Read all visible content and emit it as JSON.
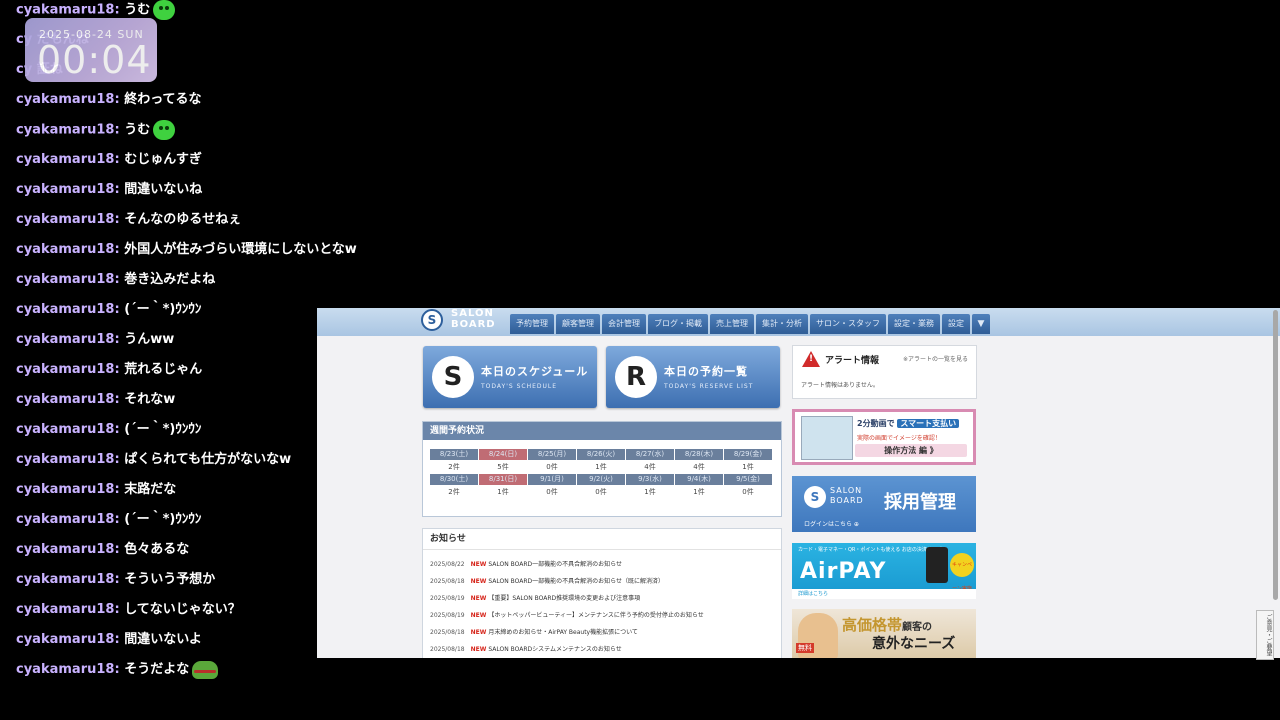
{
  "clock": {
    "date": "2025-08-24 SUN",
    "time": "00:04"
  },
  "chat": [
    {
      "user": "cyakamaru18:",
      "text": "うむ",
      "emote": "green-face-emote"
    },
    {
      "user": "cy",
      "text": "だもんね",
      "emote": ""
    },
    {
      "user": "cy",
      "text": "証ね",
      "emote": ""
    },
    {
      "user": "cyakamaru18:",
      "text": "終わってるな",
      "emote": ""
    },
    {
      "user": "cyakamaru18:",
      "text": "うむ",
      "emote": "green-face-emote"
    },
    {
      "user": "cyakamaru18:",
      "text": "むじゅんすぎ",
      "emote": ""
    },
    {
      "user": "cyakamaru18:",
      "text": "間違いないね",
      "emote": ""
    },
    {
      "user": "cyakamaru18:",
      "text": "そんなのゆるせねぇ",
      "emote": ""
    },
    {
      "user": "cyakamaru18:",
      "text": "外国人が住みづらい環境にしないとなw",
      "emote": ""
    },
    {
      "user": "cyakamaru18:",
      "text": "巻き込みだよね",
      "emote": ""
    },
    {
      "user": "cyakamaru18:",
      "text": "(´ー｀*)ｳﾝｳﾝ",
      "emote": ""
    },
    {
      "user": "cyakamaru18:",
      "text": "うんww",
      "emote": ""
    },
    {
      "user": "cyakamaru18:",
      "text": "荒れるじゃん",
      "emote": ""
    },
    {
      "user": "cyakamaru18:",
      "text": "それなw",
      "emote": ""
    },
    {
      "user": "cyakamaru18:",
      "text": "(´ー｀*)ｳﾝｳﾝ",
      "emote": ""
    },
    {
      "user": "cyakamaru18:",
      "text": "ぱくられても仕方がないなw",
      "emote": ""
    },
    {
      "user": "cyakamaru18:",
      "text": "末路だな",
      "emote": ""
    },
    {
      "user": "cyakamaru18:",
      "text": "(´ー｀*)ｳﾝｳﾝ",
      "emote": ""
    },
    {
      "user": "cyakamaru18:",
      "text": "色々あるな",
      "emote": ""
    },
    {
      "user": "cyakamaru18:",
      "text": "そういう予想か",
      "emote": ""
    },
    {
      "user": "cyakamaru18:",
      "text": "してないじゃない？",
      "emote": ""
    },
    {
      "user": "cyakamaru18:",
      "text": "間違いないよ",
      "emote": ""
    },
    {
      "user": "cyakamaru18:",
      "text": "そうだよな",
      "emote": "frog-emote"
    }
  ],
  "site": {
    "logo": {
      "mark": "S",
      "line1": "SALON",
      "line2": "BOARD"
    },
    "nav": [
      "予約管理",
      "顧客管理",
      "会計管理",
      "ブログ・掲載",
      "売上管理",
      "集計・分析",
      "サロン・スタッフ",
      "設定・業務",
      "設定"
    ],
    "nav_more": "▼",
    "schedule_btn": {
      "icon": "S",
      "title": "本日のスケジュール",
      "sub": "TODAY'S SCHEDULE"
    },
    "reserve_btn": {
      "icon": "R",
      "title": "本日の予約一覧",
      "sub": "TODAY'S RESERVE LIST"
    },
    "weekly": {
      "title": "週間予約状況",
      "week1": {
        "dates": [
          "8/23(土)",
          "8/24(日)",
          "8/25(月)",
          "8/26(火)",
          "8/27(水)",
          "8/28(木)",
          "8/29(金)"
        ],
        "counts": [
          "2件",
          "5件",
          "0件",
          "1件",
          "4件",
          "4件",
          "1件"
        ]
      },
      "week2": {
        "dates": [
          "8/30(土)",
          "8/31(日)",
          "9/1(月)",
          "9/2(火)",
          "9/3(水)",
          "9/4(木)",
          "9/5(金)"
        ],
        "counts": [
          "2件",
          "1件",
          "0件",
          "0件",
          "1件",
          "1件",
          "0件"
        ]
      }
    },
    "news": {
      "title": "お知らせ",
      "items": [
        {
          "date": "2025/08/22",
          "new": "NEW",
          "text": "SALON BOARD一部機能の不具合解消のお知らせ"
        },
        {
          "date": "2025/08/18",
          "new": "NEW",
          "text": "SALON BOARD一部機能の不具合解消のお知らせ（既に解消済）"
        },
        {
          "date": "2025/08/19",
          "new": "NEW",
          "text": "【重要】SALON BOARD推奨環境の変更および注意事項"
        },
        {
          "date": "2025/08/19",
          "new": "NEW",
          "text": "【ホットペッパービューティー】メンテナンスに伴う予約の受付停止のお知らせ"
        },
        {
          "date": "2025/08/18",
          "new": "NEW",
          "text": "月末締めのお知らせ・AirPAY Beauty機能拡張について"
        },
        {
          "date": "2025/08/18",
          "new": "NEW",
          "text": "SALON BOARDシステムメンテナンスのお知らせ"
        }
      ]
    },
    "alert": {
      "title": "アラート情報",
      "link": "※アラートの一覧を見る",
      "body": "アラート情報はありません。"
    },
    "ad_video": {
      "prefix": "2分動画で",
      "highlight": "スマート支払い",
      "sub": "実際の画面でイメージを確認！",
      "button": "操作方法 編 》"
    },
    "ad_recruit": {
      "mark": "S",
      "logo1": "SALON",
      "logo2": "BOARD",
      "title": "採用管理",
      "login": "ログインはこちら ⊕"
    },
    "ad_airpay": {
      "top": "カード・電子マネー・QR・ポイントも使える お店の決済サービス",
      "logo": "AirPAY",
      "badge": "キャンペーン実施中",
      "bottom": "詳細はこちら"
    },
    "ad_needs": {
      "word1": "高価格帯",
      "word2": "顧客の",
      "word3": "意外なニーズ",
      "badge": "無料"
    },
    "side_tab": "ご意見・ご要望"
  }
}
